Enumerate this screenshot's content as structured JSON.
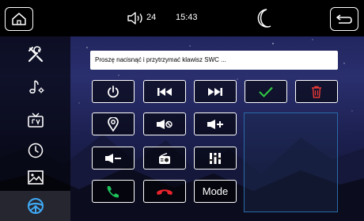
{
  "status_bar": {
    "volume": "24",
    "time": "15:43"
  },
  "prompt": {
    "text": "Proszę nacisnąć i przytrzymać klawisz SWC ..."
  },
  "keys": {
    "mode_label": "Mode"
  },
  "colors": {
    "confirm": "#2ecc40",
    "delete": "#e53935",
    "call_answer": "#1ec25a",
    "call_hangup": "#e8232b",
    "preview_border": "#2a6ba8"
  },
  "icons": {
    "sidebar": [
      "tools-icon",
      "music-settings-icon",
      "tv-icon",
      "clock-icon",
      "image-icon",
      "steering-wheel-icon"
    ],
    "top": [
      "home-icon",
      "volume-icon",
      "moon-icon",
      "back-icon"
    ]
  }
}
